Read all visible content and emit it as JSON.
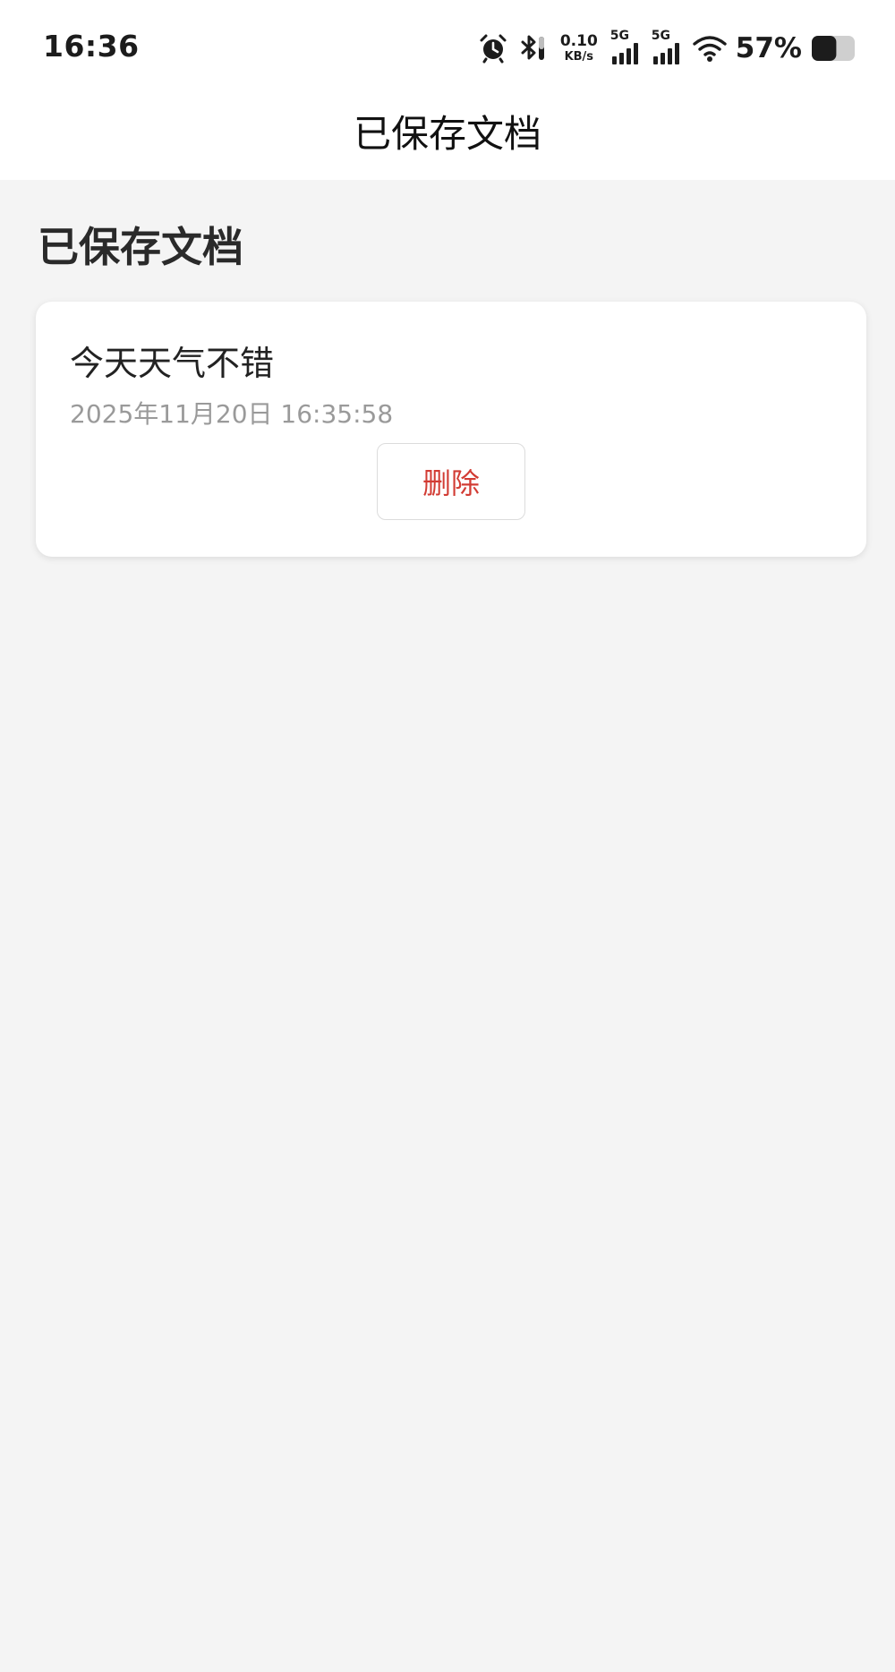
{
  "status_bar": {
    "time": "16:36",
    "net_speed_value": "0.10",
    "net_speed_unit": "KB/s",
    "sim1_label": "5G",
    "sim2_label": "5G",
    "battery_percent": "57%",
    "battery_level": 0.57,
    "icons": [
      "alarm-icon",
      "bluetooth-icon",
      "signal-icon",
      "wifi-icon",
      "battery-icon"
    ]
  },
  "appbar": {
    "title": "已保存文档"
  },
  "page": {
    "heading": "已保存文档"
  },
  "documents": [
    {
      "title": "今天天气不错",
      "saved_at": "2025年11月20日 16:35:58",
      "delete_label": "删除"
    }
  ],
  "colors": {
    "background": "#f4f4f4",
    "card": "#ffffff",
    "delete_text": "#d23c34",
    "timestamp": "#9a9a9a"
  }
}
